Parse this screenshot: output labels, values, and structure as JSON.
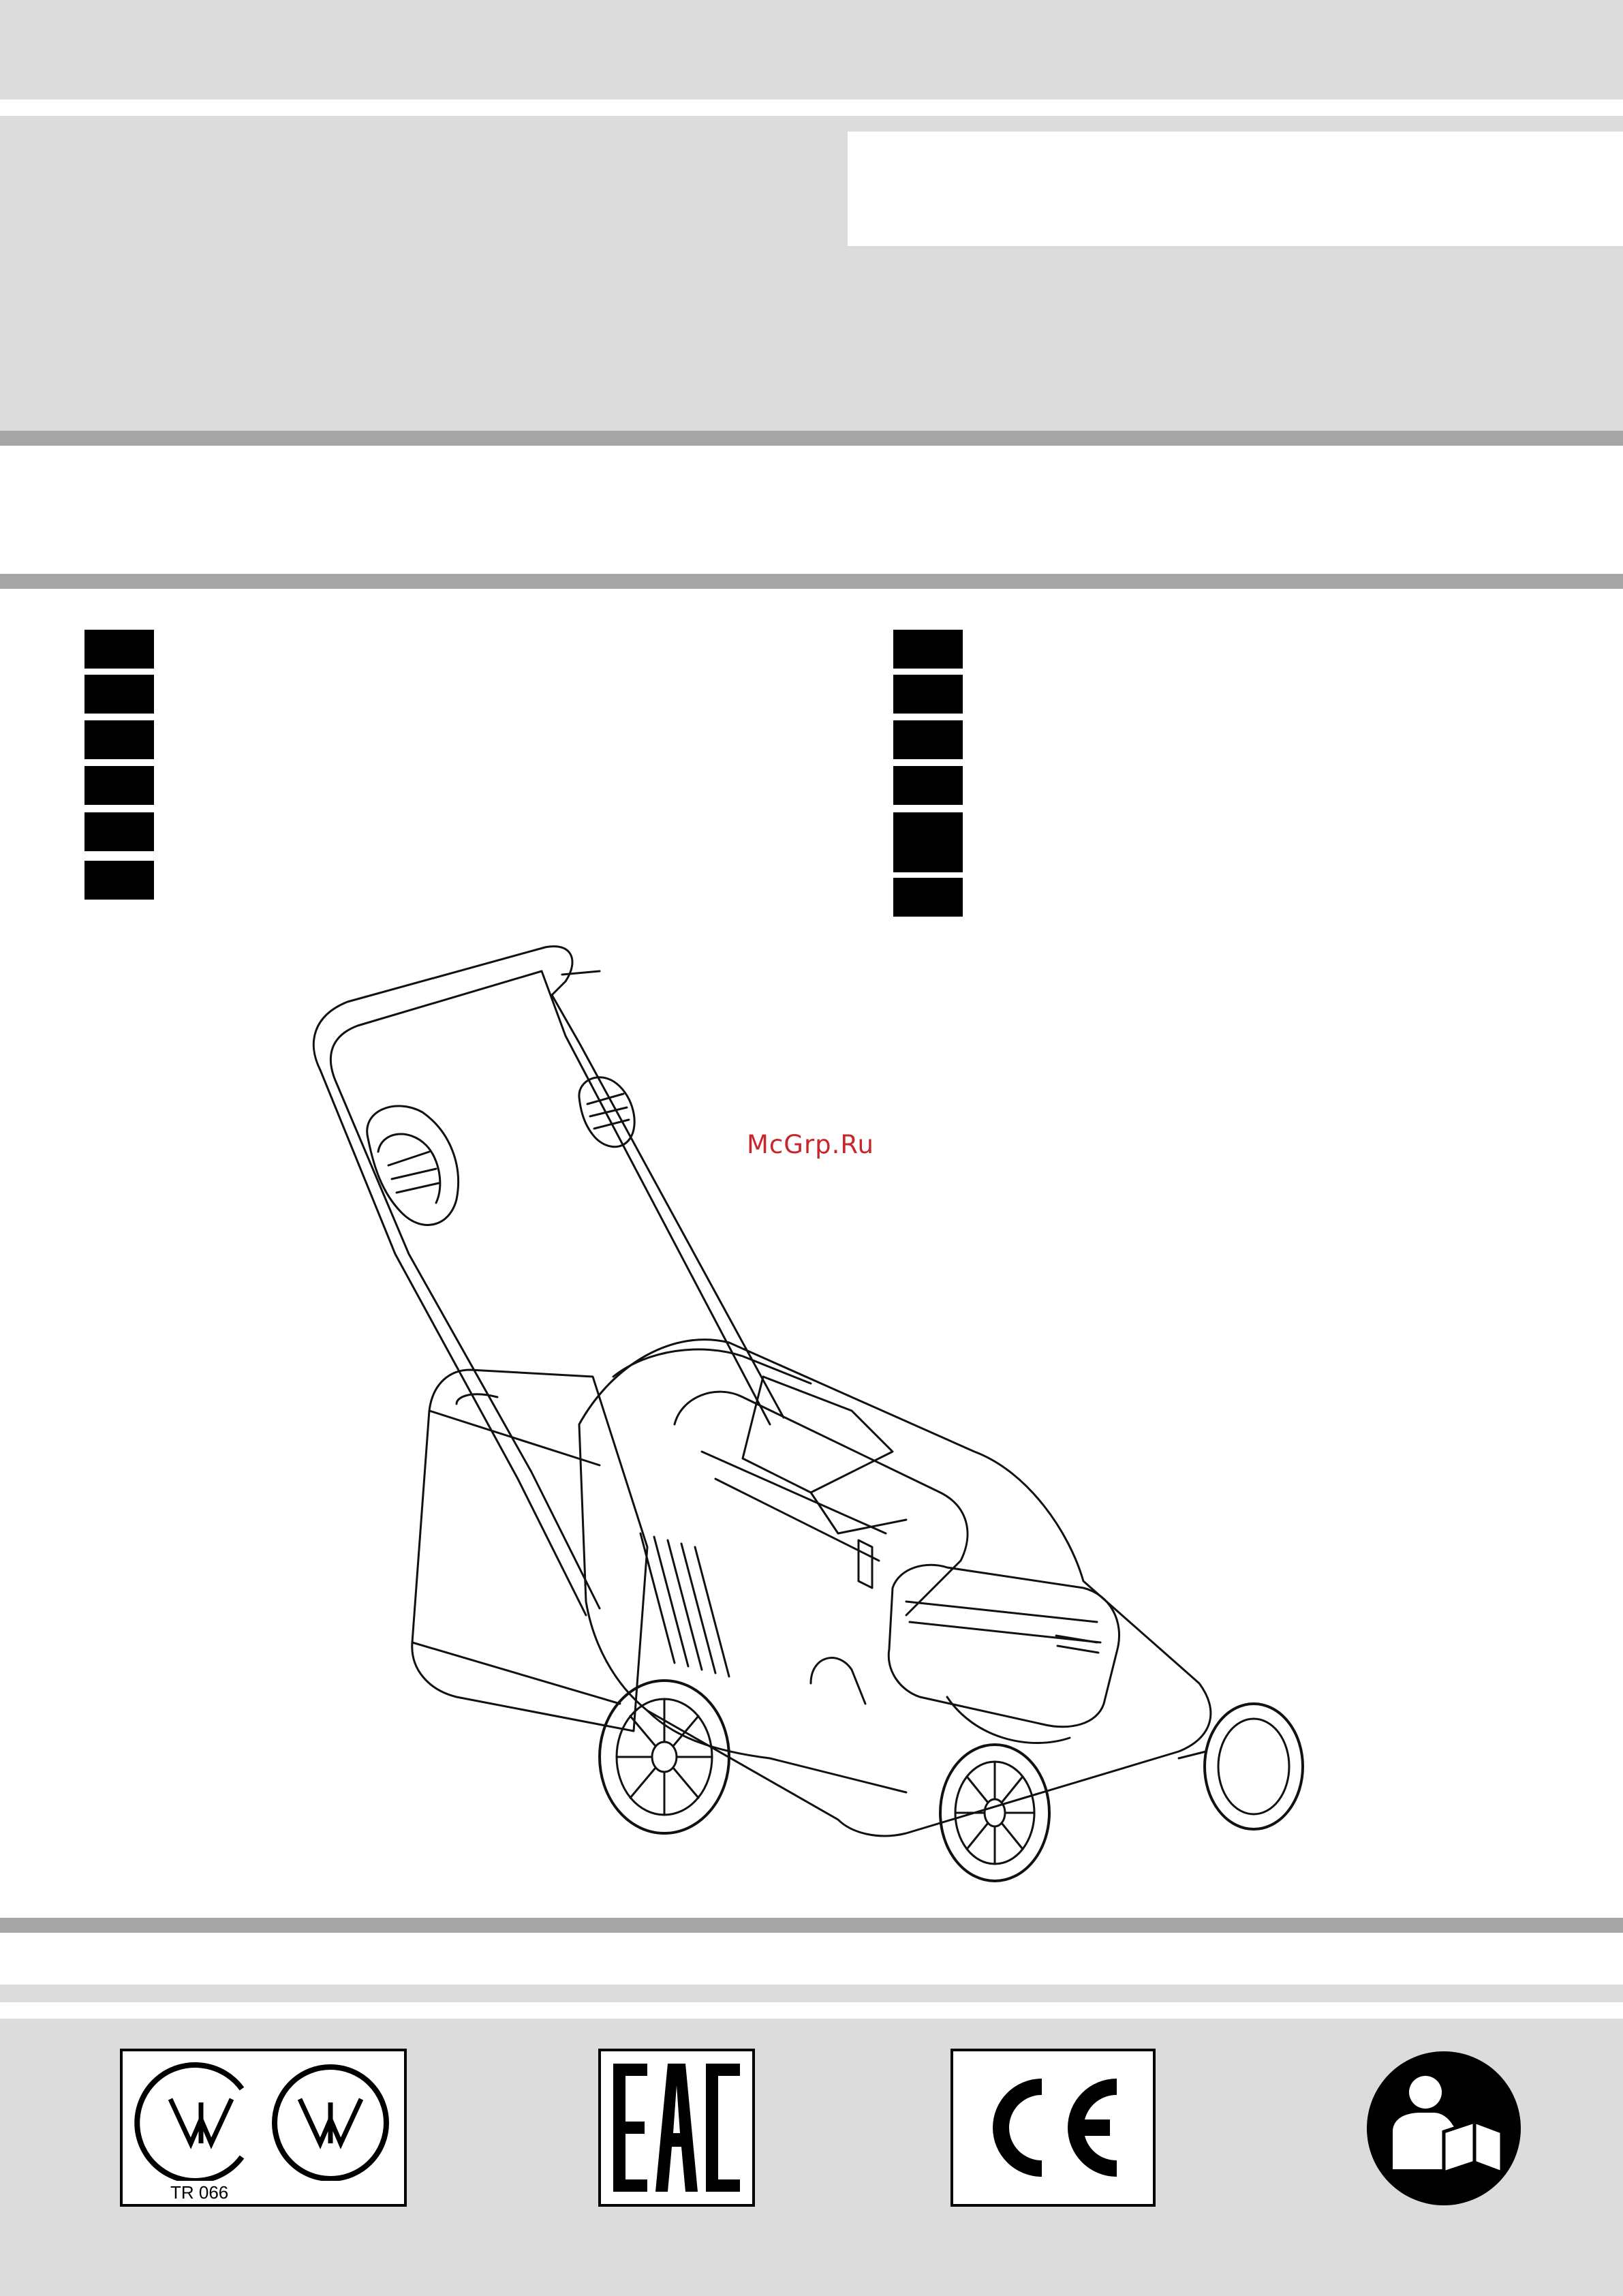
{
  "watermark": "McGrp.Ru",
  "certifications": {
    "ukraine_mark": {
      "icon": "ukraine-conformity-mark-icon",
      "label": "TR 066"
    },
    "eac_mark": {
      "icon": "eac-mark-icon"
    },
    "ce_mark": {
      "icon": "ce-mark-icon"
    },
    "manual": {
      "icon": "read-manual-icon"
    }
  },
  "colors": {
    "band_light": "#dcdcdc",
    "band_mid": "#a6a6a6",
    "language_tab": "#000000",
    "watermark": "#c8262a"
  }
}
